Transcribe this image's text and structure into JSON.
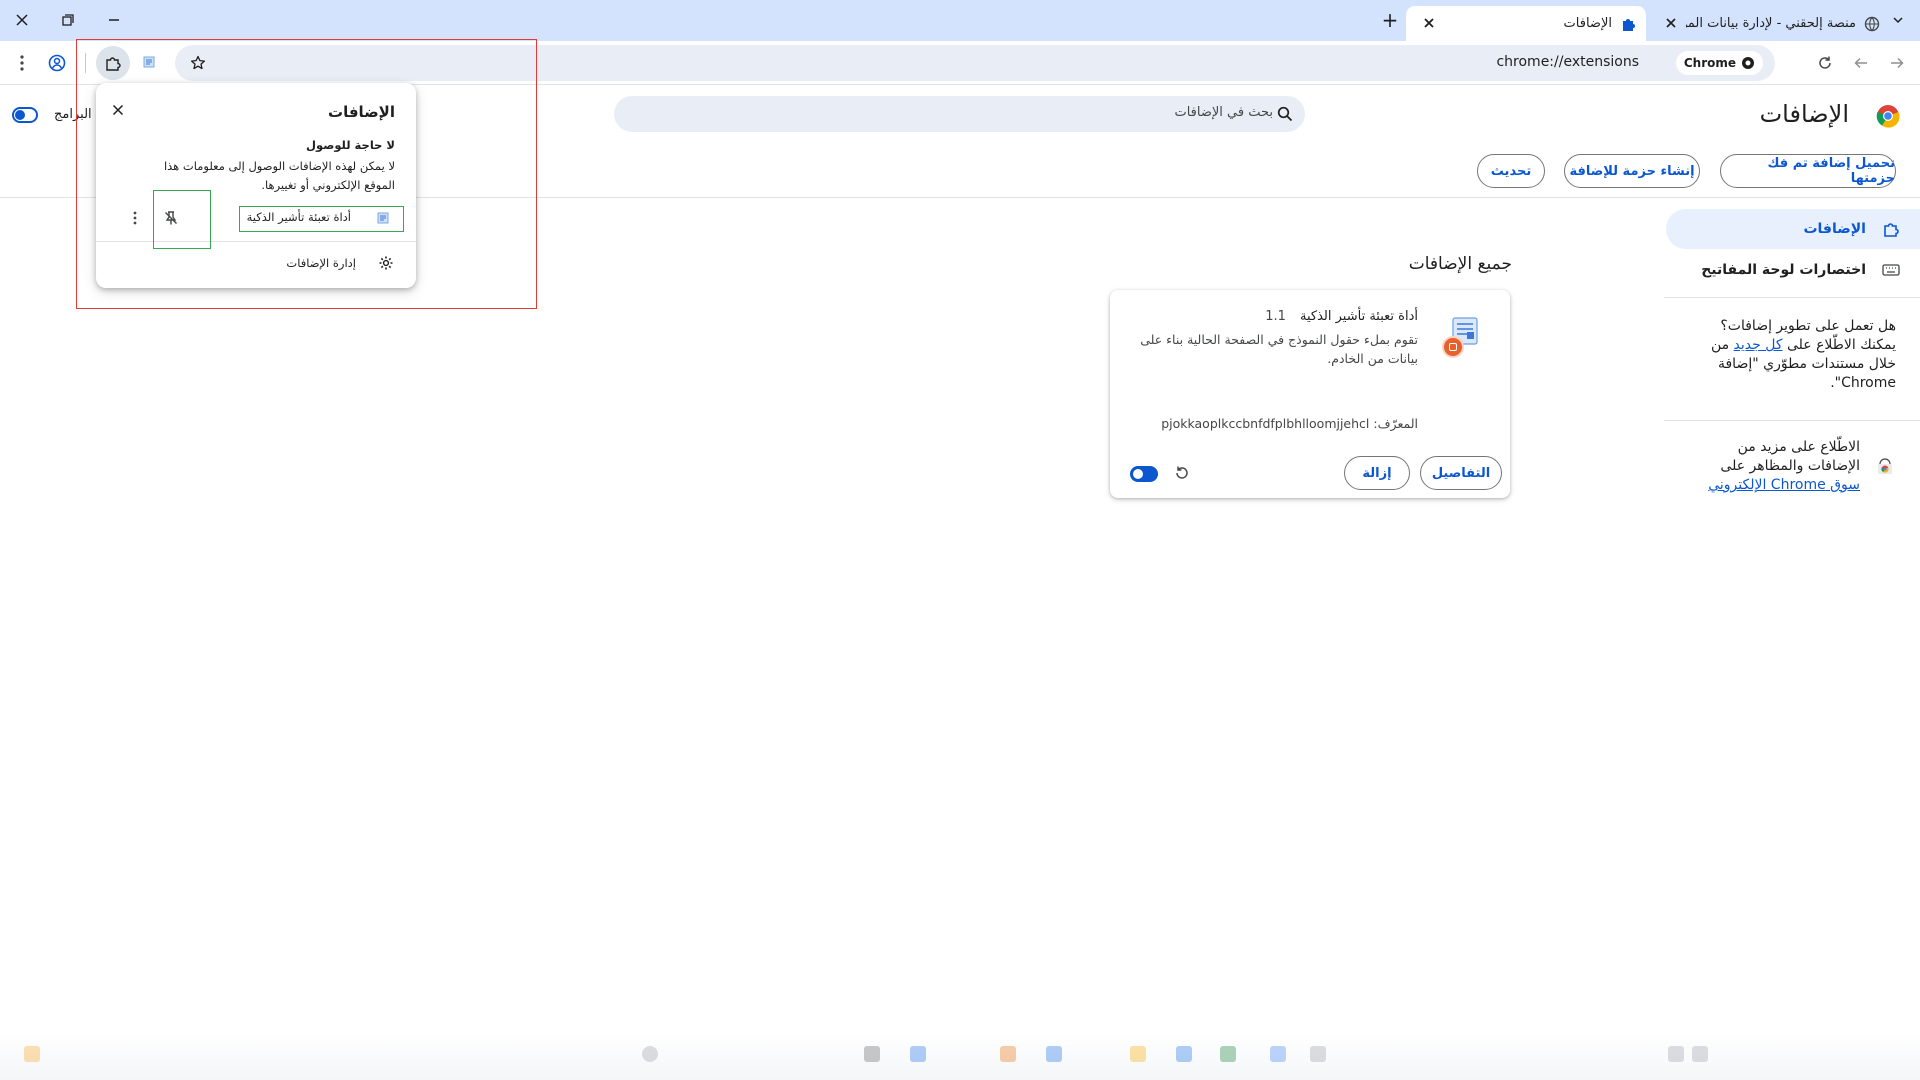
{
  "window": {
    "tabs": [
      {
        "title": "منصة إلحقني - لإدارة بيانات المن",
        "active": false
      },
      {
        "title": "الإضافات",
        "active": true
      }
    ],
    "new_tab_label": "+"
  },
  "toolbar": {
    "url": "chrome://extensions",
    "chip_label": "Chrome"
  },
  "page": {
    "title": "الإضافات",
    "search_placeholder": "بحث في الإضافات",
    "developer_mode_label": "البرامج",
    "buttons": {
      "load_unpacked": "تحميل إضافة تم فك حزمتها",
      "pack": "إنشاء حزمة للإضافة",
      "update": "تحديث"
    }
  },
  "sidebar": {
    "items": [
      {
        "label": "الإضافات",
        "active": true,
        "icon": "puzzle-icon"
      },
      {
        "label": "اختصارات لوحة المفاتيح",
        "active": false,
        "icon": "keyboard-icon"
      }
    ],
    "dev_text_1": "هل تعمل على تطوير إضافات؟ يمكنك الاطّلاع على",
    "dev_link": "كل جديد",
    "dev_text_2": "من خلال مستندات مطوّري \"إضافة Chrome\".",
    "store_text": "الاطّلاع على مزيد من الإضافات والمظاهر على",
    "store_link": "سوق Chrome الإلكتروني"
  },
  "main": {
    "section_title": "جميع الإضافات",
    "extension": {
      "name": "أداة تعبئة تأشير الذكية",
      "version": "1.1",
      "description": "تقوم بملء حقول النموذج في الصفحة الحالية بناء على بيانات من الخادم.",
      "id_label": "المعرّف:",
      "id": "pjokkaoplkccbnfdfplbhlloomjjehcl",
      "details_label": "التفاصيل",
      "remove_label": "إزالة",
      "enabled": true
    }
  },
  "popup": {
    "title": "الإضافات",
    "heading": "لا حاجة للوصول",
    "message": "لا يمكن لهذه الإضافات الوصول إلى معلومات هذا الموقع الإلكتروني أو تغييرها.",
    "item_label": "أداة تعبئة تأشير الذكية",
    "manage_label": "إدارة الإضافات"
  },
  "colors": {
    "accent": "#0b57d0",
    "tabstrip": "#d3e3fd",
    "omnibox": "#e9eef6",
    "annotation_red": "#e53935",
    "annotation_green": "#34a853"
  }
}
